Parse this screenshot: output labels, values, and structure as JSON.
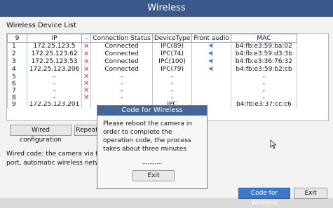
{
  "window": {
    "title": "Wireless"
  },
  "list_title": "Wireless Device List",
  "table": {
    "headers": [
      "9",
      "IP",
      "-",
      "Connection Status",
      "DeviceType",
      "Front audio",
      "MAC"
    ],
    "rows": [
      {
        "no": "1",
        "ip": "172.25.123.5",
        "x": true,
        "status": "Connected",
        "type": "IPC(89)",
        "audio": true,
        "mac": "b4:fb:e3:59:ba:02"
      },
      {
        "no": "2",
        "ip": "172.25.123.62",
        "x": true,
        "status": "Connected",
        "type": "IPC(74)",
        "audio": true,
        "mac": "b4:fb:e3:59:d3:3b"
      },
      {
        "no": "3",
        "ip": "172.25.123.53",
        "x": true,
        "status": "Connected",
        "type": "IPC(100)",
        "audio": true,
        "mac": "b4:fb:e3:36:76:32"
      },
      {
        "no": "4",
        "ip": "172.25.123.206",
        "x": true,
        "status": "Connected",
        "type": "IPC(79)",
        "audio": true,
        "mac": "b4:fb:e3:59:b2:cb"
      },
      {
        "no": "5",
        "ip": "-",
        "x": true,
        "status": "-",
        "type": "-",
        "audio": false,
        "mac": "-"
      },
      {
        "no": "6",
        "ip": "-",
        "x": true,
        "status": "-",
        "type": "-",
        "audio": false,
        "mac": "-"
      },
      {
        "no": "7",
        "ip": "-",
        "x": true,
        "status": "-",
        "type": "-",
        "audio": false,
        "mac": "-"
      },
      {
        "no": "8",
        "ip": "-",
        "x": true,
        "status": "-",
        "type": "-",
        "audio": false,
        "mac": "-"
      },
      {
        "no": "9",
        "ip": "172.25.123.201",
        "x": false,
        "status": "",
        "type": "IPC",
        "audio": false,
        "mac": "b4:fb:e3:37:cc:c6"
      }
    ]
  },
  "buttons": {
    "wired_config": "Wired configuration",
    "repeat": "Repeat",
    "code_for_wireless": "Code for Wireless",
    "exit": "Exit"
  },
  "description": "Wired code: the camera via the port, automatic wireless netw",
  "dialog": {
    "title": "Code for Wireless",
    "message": "Please reboot the camera in order to complete the operation code, the process takes about three minutes",
    "dots": "...........",
    "exit": "Exit"
  },
  "colors": {
    "titlebar": "#3a5a8c",
    "accent_button": "#3f78c9",
    "error_x": "#e23b2b",
    "audio_icon": "#4a6fe0"
  }
}
